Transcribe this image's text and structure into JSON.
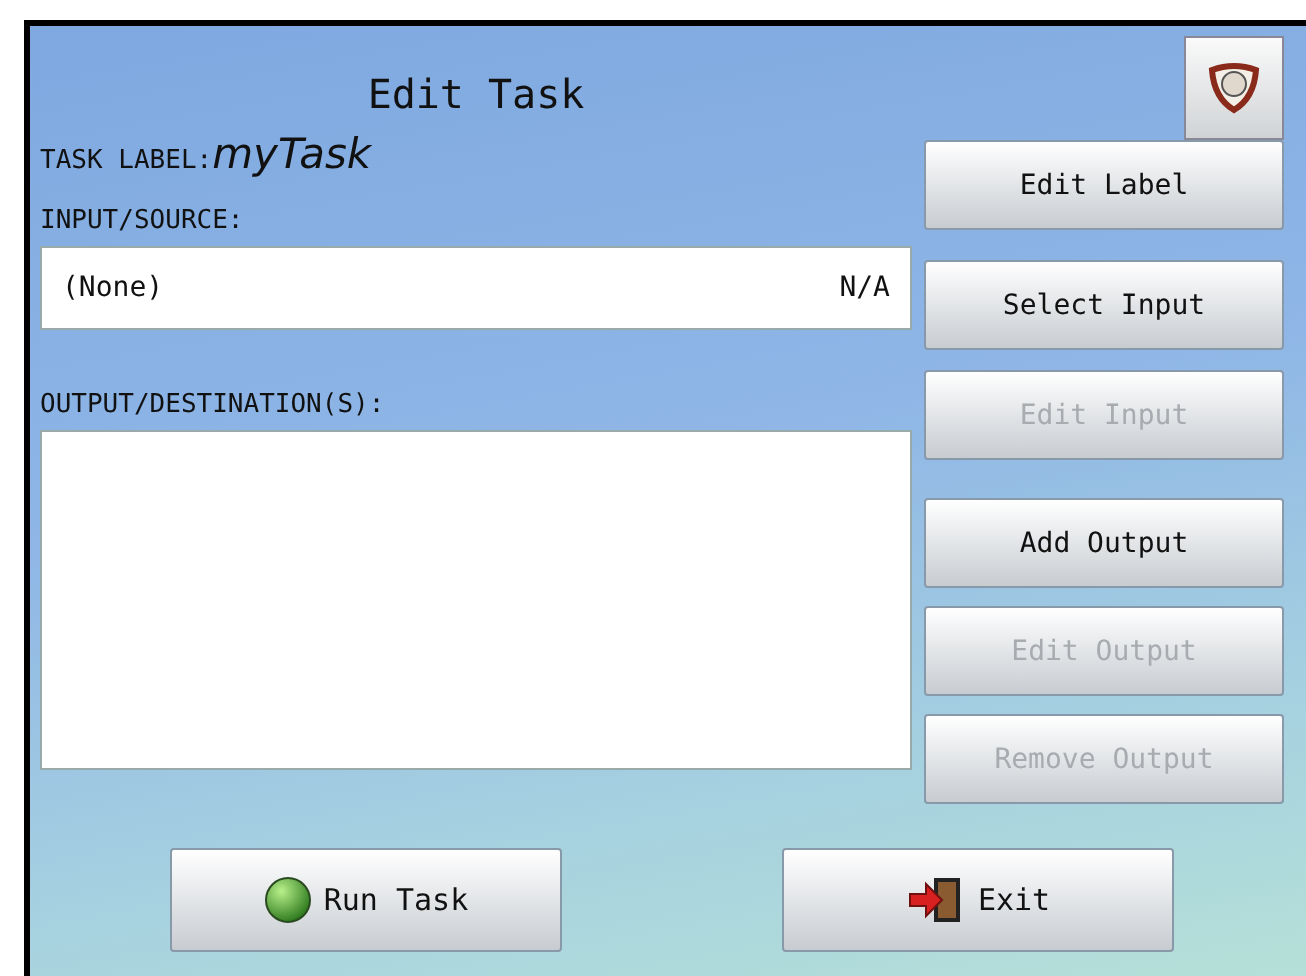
{
  "title": "Edit Task",
  "task_label": {
    "label": "TASK LABEL:",
    "value": "myTask"
  },
  "input_source": {
    "label": "INPUT/SOURCE:",
    "value": "(None)",
    "status": "N/A"
  },
  "outputs": {
    "label": "OUTPUT/DESTINATION(S):"
  },
  "side_buttons": [
    {
      "label": "Edit Label",
      "disabled": false
    },
    {
      "label": "Select Input",
      "disabled": false
    },
    {
      "label": "Edit Input",
      "disabled": true
    },
    {
      "label": "Add Output",
      "disabled": false
    },
    {
      "label": "Edit Output",
      "disabled": true
    },
    {
      "label": "Remove Output",
      "disabled": true
    }
  ],
  "bottom_buttons": [
    {
      "label": "Run Task",
      "kind": "run"
    },
    {
      "label": "Exit",
      "kind": "exit"
    }
  ]
}
